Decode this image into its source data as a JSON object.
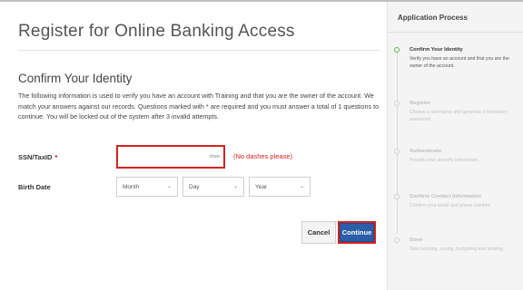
{
  "header": {
    "title": "Register for Online Banking Access"
  },
  "form": {
    "section_title": "Confirm Your Identity",
    "description": "The following information is used to verify you have an account with Training and that you are the owner of the account. We match your answers against our records. Questions marked with * are required and you must answer a total of 1 questions to continue. You will be locked out of the system after 3 invalid attempts.",
    "ssn": {
      "label": "SSN/TaxID",
      "required_mark": "*",
      "value": "",
      "show_label": "show",
      "hint": "(No dashes please)"
    },
    "birth_date": {
      "label": "Birth Date",
      "month": "Month",
      "day": "Day",
      "year": "Year"
    },
    "buttons": {
      "cancel": "Cancel",
      "continue": "Continue"
    }
  },
  "sidebar": {
    "title": "Application Process",
    "steps": [
      {
        "name": "Confirm Your Identity",
        "desc": "Verify you have an account and that you are the owner of the account.",
        "active": true
      },
      {
        "name": "Register",
        "desc": "Choose a username and generate a temporary password.",
        "active": false
      },
      {
        "name": "Authenticate",
        "desc": "Provide your security information.",
        "active": false
      },
      {
        "name": "Confirm Contact Information",
        "desc": "Confirm your email and phone number.",
        "active": false
      },
      {
        "name": "Done",
        "desc": "Start banking, saving, budgeting and sharing.",
        "active": false
      }
    ]
  },
  "colors": {
    "error": "#d62020",
    "primary": "#2b5da8",
    "active_step": "#58b04a"
  }
}
